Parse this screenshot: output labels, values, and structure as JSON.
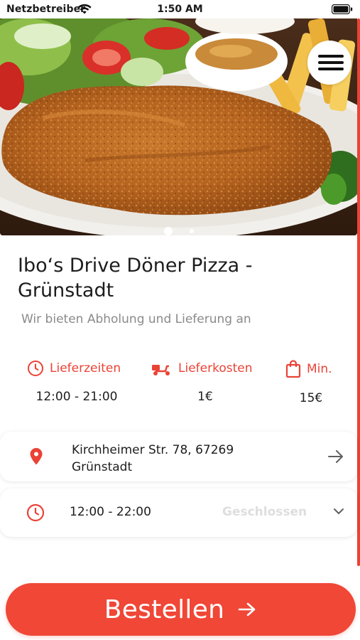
{
  "status_bar": {
    "carrier": "Netzbetreiber",
    "time": "1:50 AM"
  },
  "hero": {
    "image": "schnitzel-with-salad-fries-and-dip",
    "slide_count": 2,
    "active_slide": 1
  },
  "menu": {
    "icon": "hamburger-icon"
  },
  "restaurant": {
    "name": "Ibo‘s Drive Döner Pizza - Grünstadt",
    "tagline": "Wir bieten Abholung und Lieferung an"
  },
  "info": [
    {
      "icon": "clock-icon",
      "label": "Lieferzeiten",
      "value": "12:00 - 21:00"
    },
    {
      "icon": "scooter-icon",
      "label": "Lieferkosten",
      "value": "1€"
    },
    {
      "icon": "shopping-bag-icon",
      "label": "Min.",
      "value": "15€"
    }
  ],
  "address": {
    "line1": "Kirchheimer Str. 78, 67269",
    "line2": "Grünstadt"
  },
  "opening": {
    "hours": "12:00 - 22:00",
    "state": "Geschlossen"
  },
  "order_button": {
    "label": "Bestellen"
  },
  "colors": {
    "accent": "#ea4336",
    "button": "#f04737",
    "muted_text": "#8a8a8a",
    "disabled_text": "#dedede"
  }
}
